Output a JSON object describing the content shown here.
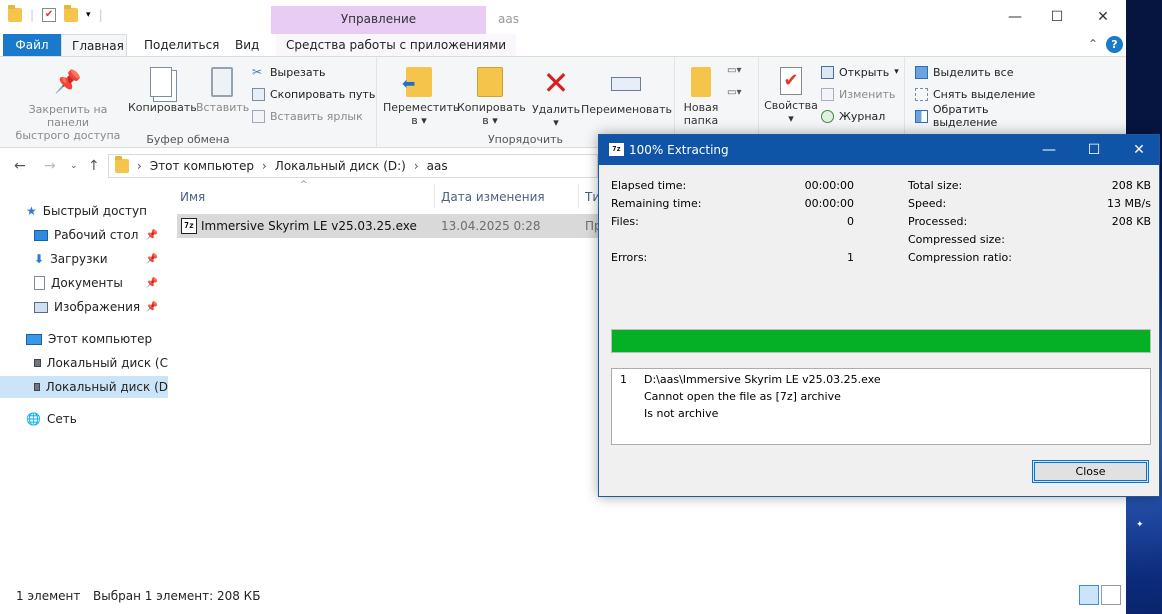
{
  "explorer": {
    "window_title": "aas",
    "context_tab": "Управление",
    "tabs": [
      "Файл",
      "Главная",
      "Поделиться",
      "Вид",
      "Средства работы с приложениями"
    ],
    "ribbon": {
      "clipboard": {
        "group_label": "Буфер обмена",
        "pin_label_1": "Закрепить на панели",
        "pin_label_2": "быстрого доступа",
        "copy_label": "Копировать",
        "paste_label": "Вставить",
        "cut_label": "Вырезать",
        "copy_path_label": "Скопировать путь",
        "paste_shortcut_label": "Вставить ярлык"
      },
      "organize": {
        "group_label": "Упорядочить",
        "move_label_1": "Переместить",
        "move_label_2": "в",
        "copyto_label_1": "Копировать",
        "copyto_label_2": "в",
        "delete_label": "Удалить",
        "rename_label": "Переименовать"
      },
      "new": {
        "new_folder_1": "Новая",
        "new_folder_2": "папка"
      },
      "open": {
        "properties_label": "Свойства",
        "open_label": "Открыть",
        "edit_label": "Изменить",
        "history_label": "Журнал"
      },
      "select": {
        "select_all": "Выделить все",
        "select_none": "Снять выделение",
        "invert": "Обратить выделение"
      }
    },
    "address": {
      "crumb1": "Этот компьютер",
      "crumb2": "Локальный диск (D:)",
      "crumb3": "aas"
    },
    "nav": {
      "quick_access": "Быстрый доступ",
      "desktop": "Рабочий стол",
      "downloads": "Загрузки",
      "documents": "Документы",
      "pictures": "Изображения",
      "this_pc": "Этот компьютер",
      "disk_c": "Локальный диск (C",
      "disk_d": "Локальный диск (D",
      "network": "Сеть"
    },
    "columns": {
      "name": "Имя",
      "date": "Дата изменения",
      "type": "Тип"
    },
    "files": [
      {
        "name": "Immersive Skyrim LE v25.03.25.exe",
        "date": "13.04.2025 0:28",
        "type": "Пр"
      }
    ],
    "status": {
      "count": "1 элемент",
      "selected": "Выбран 1 элемент: 208 КБ"
    }
  },
  "dialog": {
    "title": "100% Extracting",
    "icon_text": "7z",
    "stats_left": [
      {
        "label": "Elapsed time:",
        "value": "00:00:00"
      },
      {
        "label": "Remaining time:",
        "value": "00:00:00"
      },
      {
        "label": "Files:",
        "value": "0"
      },
      {
        "label": "Errors:",
        "value": "1"
      }
    ],
    "stats_right": [
      {
        "label": "Total size:",
        "value": "208 KB"
      },
      {
        "label": "Speed:",
        "value": "13 MB/s"
      },
      {
        "label": "Processed:",
        "value": "208 KB"
      },
      {
        "label": "Compressed size:",
        "value": ""
      },
      {
        "label": "Compression ratio:",
        "value": ""
      }
    ],
    "progress_percent": 100,
    "progress_color": "#06b025",
    "messages": {
      "index": "1",
      "path": "D:\\aas\\Immersive Skyrim LE v25.03.25.exe",
      "line2": "Cannot open the file as [7z] archive",
      "line3": "Is not archive"
    },
    "close_label": "Close"
  }
}
